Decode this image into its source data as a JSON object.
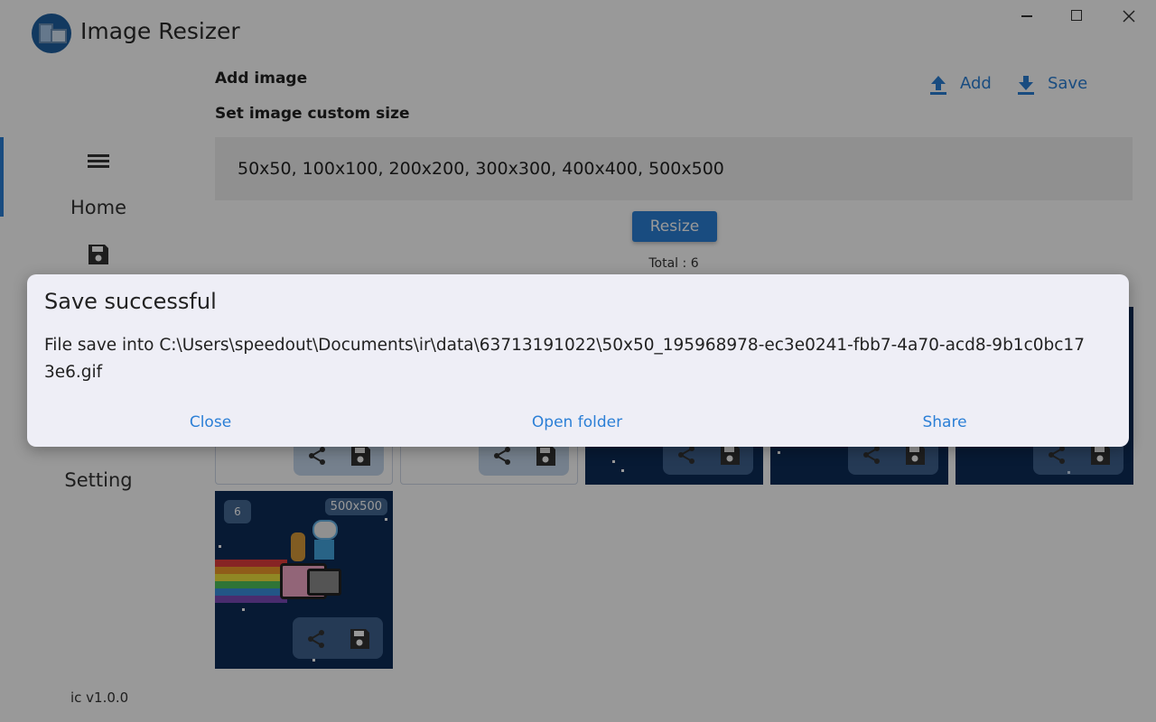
{
  "app": {
    "title": "Image Resizer",
    "version": "ic v1.0.0"
  },
  "window_controls": [
    "minimize",
    "maximize",
    "close"
  ],
  "sidebar": {
    "items": [
      {
        "label": "Home",
        "icon": "menu-icon",
        "selected": true
      },
      {
        "label": "",
        "icon": "save-icon",
        "selected": false
      },
      {
        "label": "Setting",
        "icon": "gear-icon",
        "selected": false
      }
    ]
  },
  "main": {
    "add_image_label": "Add image",
    "custom_size_label": "Set image custom size",
    "add_button": "Add",
    "save_button": "Save",
    "size_input_value": "50x50, 100x100, 200x200, 300x300, 400x400, 500x500",
    "resize_button": "Resize",
    "total": "Total : 6",
    "cards": [
      {
        "index": "6",
        "size": "500x500"
      }
    ]
  },
  "dialog": {
    "title": "Save successful",
    "message": "File save into C:\\Users\\speedout\\Documents\\ir\\data\\63713191022\\50x50_195968978-ec3e0241-fbb7-4a70-acd8-9b1c0bc173e6.gif",
    "buttons": {
      "close": "Close",
      "open_folder": "Open folder",
      "share": "Share"
    }
  },
  "colors": {
    "accent": "#2b7fd6",
    "card_background": "#0c2c57",
    "dialog_background": "#eeeef6"
  }
}
